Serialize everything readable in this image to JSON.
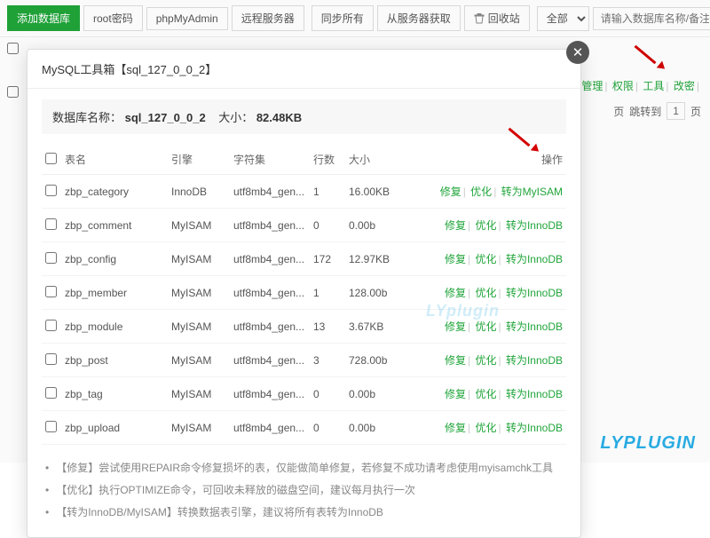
{
  "toolbar": {
    "add_db": "添加数据库",
    "root_pwd": "root密码",
    "phpmyadmin": "phpMyAdmin",
    "remote": "远程服务器",
    "sync_all": "同步所有",
    "fetch_remote": "从服务器获取",
    "recycle": "回收站",
    "filter_all": "全部",
    "search_ph": "请输入数据库名称/备注"
  },
  "bg": {
    "links": {
      "manage": "管理",
      "perm": "权限",
      "tool": "工具",
      "alter": "改密"
    },
    "pager": {
      "page": "页",
      "jump": "跳转到",
      "num": "1"
    }
  },
  "modal": {
    "title": "MySQL工具箱【sql_127_0_0_2】",
    "db_label": "数据库名称：",
    "db_name": "sql_127_0_0_2",
    "size_label": "大小：",
    "db_size": "82.48KB",
    "th": {
      "name": "表名",
      "engine": "引擎",
      "charset": "字符集",
      "rows": "行数",
      "size": "大小",
      "op": "操作"
    },
    "ops": {
      "repair": "修复",
      "optimize": "优化",
      "to_myisam": "转为MyISAM",
      "to_innodb": "转为InnoDB"
    },
    "rows": [
      {
        "name": "zbp_category",
        "engine": "InnoDB",
        "charset": "utf8mb4_gen...",
        "rows": "1",
        "size": "16.00KB",
        "convert": "to_myisam"
      },
      {
        "name": "zbp_comment",
        "engine": "MyISAM",
        "charset": "utf8mb4_gen...",
        "rows": "0",
        "size": "0.00b",
        "convert": "to_innodb"
      },
      {
        "name": "zbp_config",
        "engine": "MyISAM",
        "charset": "utf8mb4_gen...",
        "rows": "172",
        "size": "12.97KB",
        "convert": "to_innodb"
      },
      {
        "name": "zbp_member",
        "engine": "MyISAM",
        "charset": "utf8mb4_gen...",
        "rows": "1",
        "size": "128.00b",
        "convert": "to_innodb"
      },
      {
        "name": "zbp_module",
        "engine": "MyISAM",
        "charset": "utf8mb4_gen...",
        "rows": "13",
        "size": "3.67KB",
        "convert": "to_innodb"
      },
      {
        "name": "zbp_post",
        "engine": "MyISAM",
        "charset": "utf8mb4_gen...",
        "rows": "3",
        "size": "728.00b",
        "convert": "to_innodb"
      },
      {
        "name": "zbp_tag",
        "engine": "MyISAM",
        "charset": "utf8mb4_gen...",
        "rows": "0",
        "size": "0.00b",
        "convert": "to_innodb"
      },
      {
        "name": "zbp_upload",
        "engine": "MyISAM",
        "charset": "utf8mb4_gen...",
        "rows": "0",
        "size": "0.00b",
        "convert": "to_innodb"
      }
    ],
    "notes": [
      "【修复】尝试使用REPAIR命令修复损坏的表，仅能做简单修复，若修复不成功请考虑使用myisamchk工具",
      "【优化】执行OPTIMIZE命令，可回收未释放的磁盘空间，建议每月执行一次",
      "【转为InnoDB/MyISAM】转换数据表引擎，建议将所有表转为InnoDB"
    ]
  },
  "watermark": "LYPLUGIN",
  "watermark_center": "LYplugin"
}
